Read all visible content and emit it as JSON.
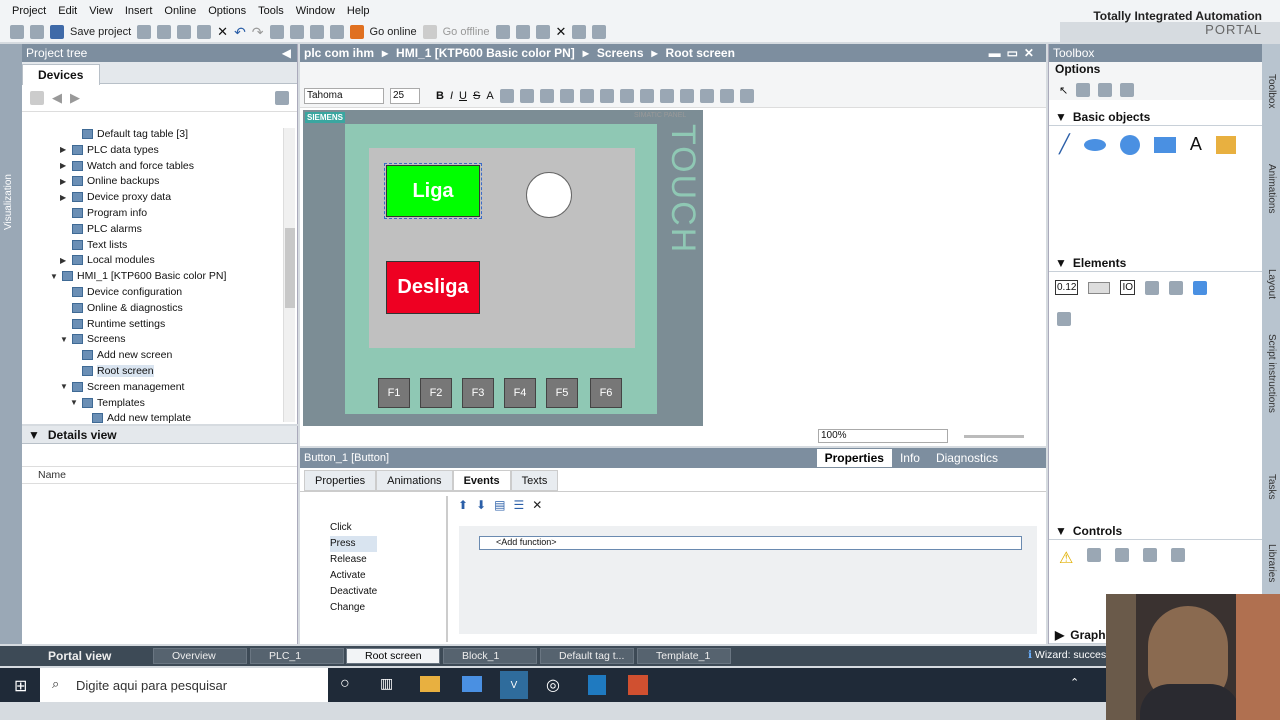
{
  "menu": [
    "Project",
    "Edit",
    "View",
    "Insert",
    "Online",
    "Options",
    "Tools",
    "Window",
    "Help"
  ],
  "brand": {
    "line1": "Totally Integrated Automation",
    "line2": "PORTAL"
  },
  "toolbar": {
    "save": "Save project",
    "go_online": "Go online",
    "go_offline": "Go offline"
  },
  "vertical_tab": "Visualization",
  "project_tree": {
    "title": "Project tree",
    "tab": "Devices",
    "items": [
      {
        "label": "Default tag table [3]",
        "indent": 4,
        "expand": ""
      },
      {
        "label": "PLC data types",
        "indent": 3,
        "expand": "▶"
      },
      {
        "label": "Watch and force tables",
        "indent": 3,
        "expand": "▶"
      },
      {
        "label": "Online backups",
        "indent": 3,
        "expand": "▶"
      },
      {
        "label": "Device proxy data",
        "indent": 3,
        "expand": "▶"
      },
      {
        "label": "Program info",
        "indent": 3,
        "expand": ""
      },
      {
        "label": "PLC alarms",
        "indent": 3,
        "expand": ""
      },
      {
        "label": "Text lists",
        "indent": 3,
        "expand": ""
      },
      {
        "label": "Local modules",
        "indent": 3,
        "expand": "▶"
      },
      {
        "label": "HMI_1 [KTP600 Basic color PN]",
        "indent": 2,
        "expand": "▼"
      },
      {
        "label": "Device configuration",
        "indent": 3,
        "expand": ""
      },
      {
        "label": "Online & diagnostics",
        "indent": 3,
        "expand": ""
      },
      {
        "label": "Runtime settings",
        "indent": 3,
        "expand": ""
      },
      {
        "label": "Screens",
        "indent": 3,
        "expand": "▼"
      },
      {
        "label": "Add new screen",
        "indent": 4,
        "expand": ""
      },
      {
        "label": "Root screen",
        "indent": 4,
        "expand": ""
      },
      {
        "label": "Screen management",
        "indent": 3,
        "expand": "▼"
      },
      {
        "label": "Templates",
        "indent": 4,
        "expand": "▼"
      },
      {
        "label": "Add new template",
        "indent": 5,
        "expand": ""
      }
    ]
  },
  "details": {
    "title": "Details view",
    "col": "Name"
  },
  "editor": {
    "breadcrumb": [
      "plc com ihm",
      "HMI_1 [KTP600 Basic color PN]",
      "Screens",
      "Root screen"
    ],
    "font": "Tahoma",
    "size": "25",
    "zoom": "100%"
  },
  "hmi": {
    "brand": "SIEMENS",
    "model": "SIMATIC PANEL",
    "touch": "TOUCH",
    "btn_on": "Liga",
    "btn_off": "Desliga",
    "fkeys": [
      "F1",
      "F2",
      "F3",
      "F4",
      "F5",
      "F6"
    ]
  },
  "props": {
    "object": "Button_1 [Button]",
    "tabs_right": [
      "Properties",
      "Info",
      "Diagnostics"
    ],
    "tabs": [
      "Properties",
      "Animations",
      "Events",
      "Texts"
    ],
    "events": [
      "Click",
      "Press",
      "Release",
      "Activate",
      "Deactivate",
      "Change"
    ],
    "add_function": "<Add function>"
  },
  "toolbox": {
    "title": "Toolbox",
    "options": "Options",
    "sections": [
      "Basic objects",
      "Elements",
      "Controls",
      "Graphi"
    ],
    "element_value": "0.12",
    "element_io": "IO"
  },
  "right_tabs": [
    "Toolbox",
    "Animations",
    "Layout",
    "Script instructions",
    "Tasks",
    "Libraries"
  ],
  "task_tabs": [
    "Portal view",
    "Overview",
    "PLC_1",
    "Root screen",
    "Block_1",
    "Default tag t...",
    "Template_1"
  ],
  "wizard": "Wizard: succes",
  "win_search": "Digite aqui para pesquisar",
  "colors": {
    "green": "#00ff00",
    "red": "#ee0022",
    "teal": "#8fc8b4",
    "header": "#7d8e9f"
  }
}
